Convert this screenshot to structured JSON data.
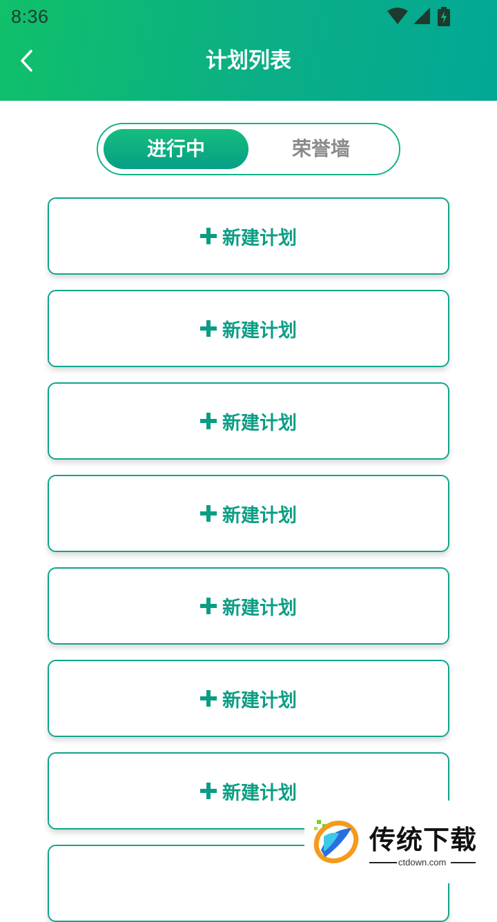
{
  "status_bar": {
    "time": "8:36"
  },
  "header": {
    "title": "计划列表"
  },
  "tabs": [
    {
      "label": "进行中",
      "active": true
    },
    {
      "label": "荣誉墙",
      "active": false
    }
  ],
  "plans": [
    {
      "label": "新建计划"
    },
    {
      "label": "新建计划"
    },
    {
      "label": "新建计划"
    },
    {
      "label": "新建计划"
    },
    {
      "label": "新建计划"
    },
    {
      "label": "新建计划"
    },
    {
      "label": "新建计划"
    },
    {
      "label": ""
    }
  ],
  "watermark": {
    "title": "传统下载",
    "domain": "ctdown.com"
  },
  "colors": {
    "accent": "#0b9d84",
    "header_start": "#10c06a",
    "header_end": "#02a895",
    "inactive_text": "#8a8a8a"
  },
  "icons": {
    "back": "chevron-left-icon",
    "add": "plus-icon",
    "wifi": "wifi-icon",
    "signal": "signal-icon",
    "battery": "battery-charging-icon"
  }
}
